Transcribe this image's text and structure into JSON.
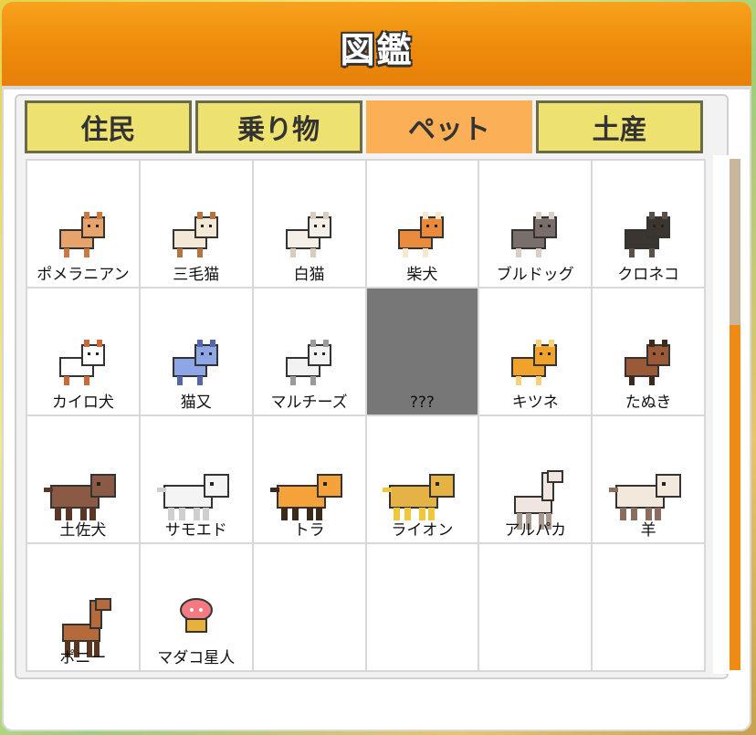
{
  "title": "図鑑",
  "tabs": [
    {
      "label": "住民",
      "active": false
    },
    {
      "label": "乗り物",
      "active": false
    },
    {
      "label": "ペット",
      "active": true
    },
    {
      "label": "土産",
      "active": false
    }
  ],
  "pets": [
    {
      "name": "ポメラニアン",
      "icon": "pomeranian-icon"
    },
    {
      "name": "三毛猫",
      "icon": "calico-cat-icon"
    },
    {
      "name": "白猫",
      "icon": "white-cat-icon"
    },
    {
      "name": "柴犬",
      "icon": "shiba-icon"
    },
    {
      "name": "ブルドッグ",
      "icon": "bulldog-icon"
    },
    {
      "name": "クロネコ",
      "icon": "black-cat-icon"
    },
    {
      "name": "カイロ犬",
      "icon": "kairo-dog-icon"
    },
    {
      "name": "猫又",
      "icon": "nekomata-icon"
    },
    {
      "name": "マルチーズ",
      "icon": "maltese-icon"
    },
    {
      "name": "???",
      "icon": "unknown",
      "unknown": true
    },
    {
      "name": "キツネ",
      "icon": "fox-icon"
    },
    {
      "name": "たぬき",
      "icon": "tanuki-icon"
    },
    {
      "name": "土佐犬",
      "icon": "tosa-dog-icon"
    },
    {
      "name": "サモエド",
      "icon": "samoyed-icon"
    },
    {
      "name": "トラ",
      "icon": "tiger-icon"
    },
    {
      "name": "ライオン",
      "icon": "lion-icon"
    },
    {
      "name": "アルパカ",
      "icon": "alpaca-icon"
    },
    {
      "name": "羊",
      "icon": "sheep-icon"
    },
    {
      "name": "ポニー",
      "icon": "pony-icon"
    },
    {
      "name": "マダコ星人",
      "icon": "octopus-alien-icon"
    },
    {
      "name": "",
      "icon": "empty"
    },
    {
      "name": "",
      "icon": "empty"
    },
    {
      "name": "",
      "icon": "empty"
    },
    {
      "name": "",
      "icon": "empty"
    }
  ],
  "colors": {
    "header": "#ee8a0b",
    "tab": "#ede170",
    "tab_active": "#fbb057",
    "scroll_thumb": "#f08a12"
  }
}
